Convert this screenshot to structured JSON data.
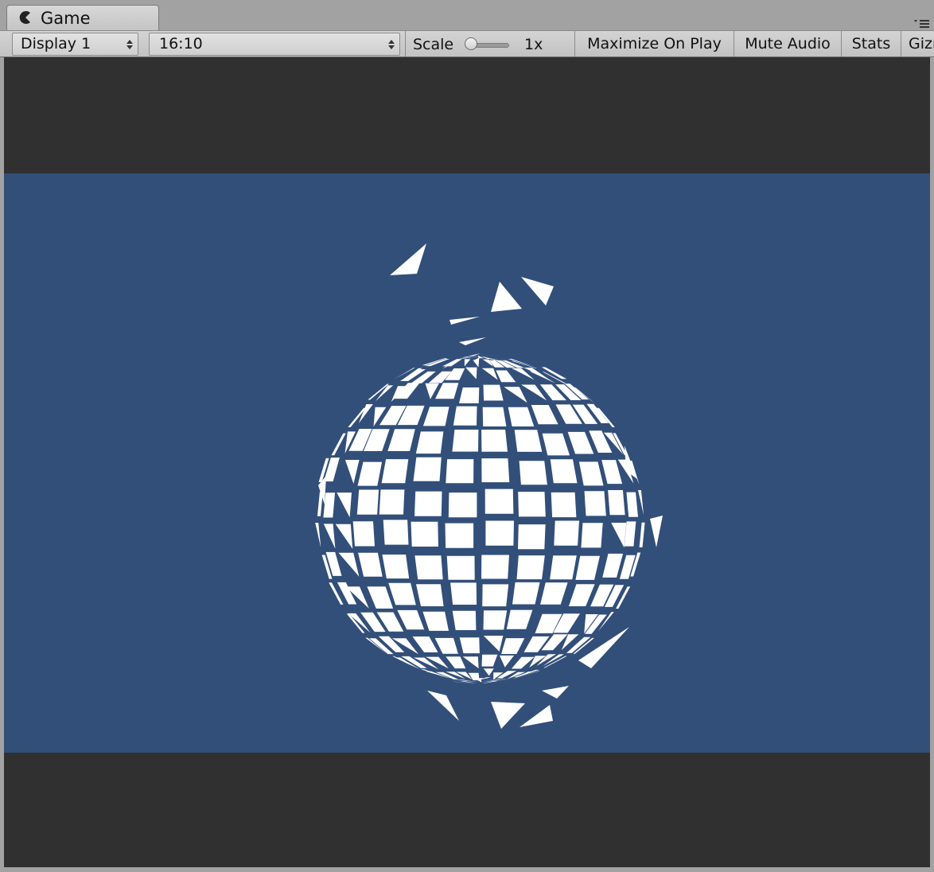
{
  "tab": {
    "title": "Game",
    "icon": "pacman-icon"
  },
  "panel_menu_icon": "panel-menu-icon",
  "toolbar": {
    "display": "Display 1",
    "aspect": "16:10",
    "scale_label": "Scale",
    "scale_value": "1x",
    "scale_slider_level": 0.0,
    "maximize_on_play": "Maximize On Play",
    "mute_audio": "Mute Audio",
    "stats": "Stats",
    "gizmos": "Gizmos"
  },
  "colors": {
    "game_background": "#324f7a",
    "letterbox": "#303030",
    "mesh_fragments": "#ffffff"
  },
  "scene": {
    "description_icon": "shattered-sphere-icon"
  }
}
